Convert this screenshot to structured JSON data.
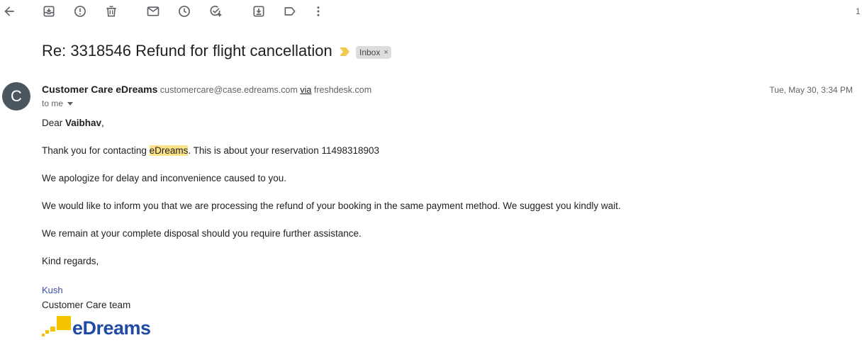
{
  "toolbar": {
    "icons": [
      "back-arrow-icon",
      "archive-icon",
      "report-spam-icon",
      "delete-icon",
      "mark-unread-icon",
      "snooze-icon",
      "add-to-tasks-icon",
      "move-to-icon",
      "labels-icon",
      "more-options-icon"
    ],
    "page_count": "1"
  },
  "email": {
    "subject": "Re: 3318546 Refund for flight cancellation",
    "label": "Inbox",
    "label_remove": "×",
    "sender": {
      "avatar_letter": "C",
      "name": "Customer Care eDreams",
      "email": "customercare@case.edreams.com",
      "via_word": "via",
      "via_domain": "freshdesk.com"
    },
    "date": "Tue, May 30, 3:34 PM",
    "to": "to me",
    "body": {
      "greeting_prefix": "Dear ",
      "greeting_name": "Vaibhav",
      "greeting_suffix": ",",
      "line1_prefix": "Thank you for contacting ",
      "line1_highlight": "eDreams",
      "line1_suffix": ". This is about your reservation 11498318903",
      "line2": "We apologize for delay and inconvenience caused to you.",
      "line3": "We would like to inform you that we are processing the refund of your booking in the same payment method. We suggest you kindly wait.",
      "line4": "We remain at your complete disposal should you require further assistance.",
      "closing": "Kind regards,"
    },
    "signature": {
      "name": "Kush",
      "team": "Customer Care team",
      "logo_text": "eDreams"
    }
  },
  "colors": {
    "avatar": "#4b5760",
    "highlight": "#fce38a",
    "logo_blue": "#1f4aa5",
    "logo_yellow": "#f5c400",
    "important_marker": "#f2c94c"
  }
}
